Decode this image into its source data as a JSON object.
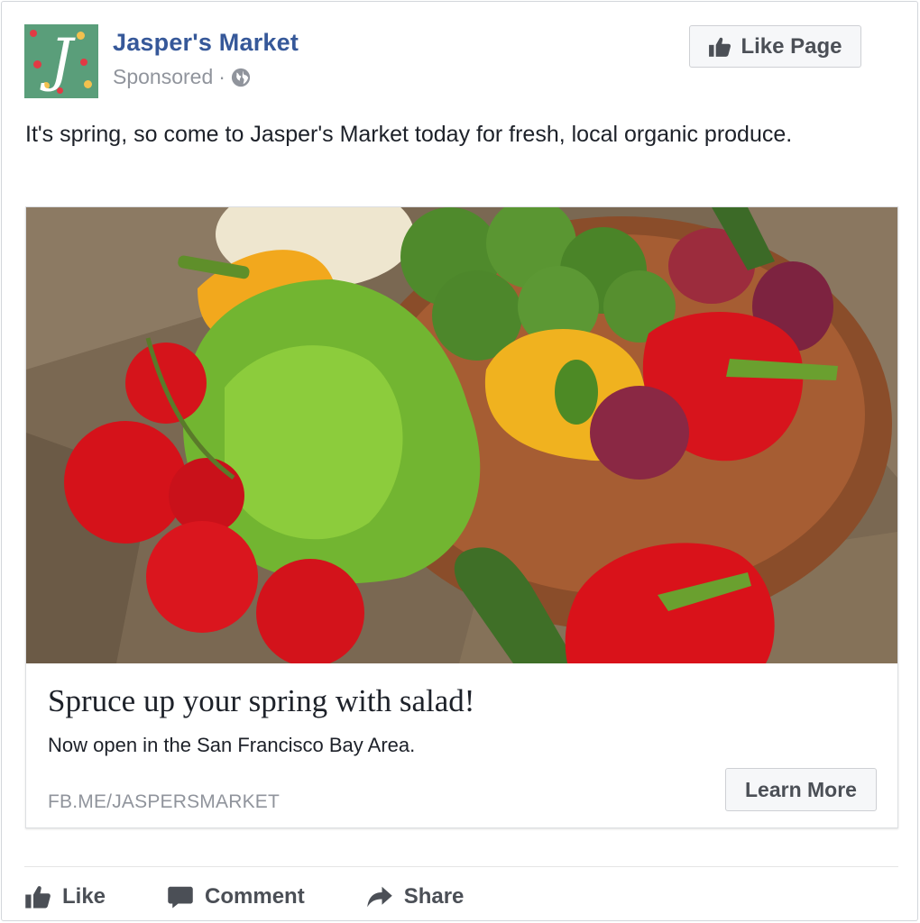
{
  "post": {
    "page_name": "Jasper's Market",
    "avatar_letter": "J",
    "sponsored_label": "Sponsored",
    "sponsored_separator": "·",
    "privacy_icon": "globe-icon",
    "like_page_label": "Like Page",
    "text": "It's spring, so come to Jasper's Market today for fresh, local organic produce."
  },
  "attachment": {
    "image_alt": "Fresh vegetables: tomatoes, lettuce, broccoli, bell peppers and red onions in a wooden bowl on burlap",
    "headline": "Spruce up your spring with salad!",
    "description": "Now open in the San Francisco Bay Area.",
    "domain": "FB.ME/JASPERSMARKET",
    "cta_label": "Learn More"
  },
  "actions": {
    "like_label": "Like",
    "comment_label": "Comment",
    "share_label": "Share"
  },
  "colors": {
    "brand_blue": "#365899",
    "muted_text": "#90949c",
    "button_text": "#4b4f56"
  }
}
